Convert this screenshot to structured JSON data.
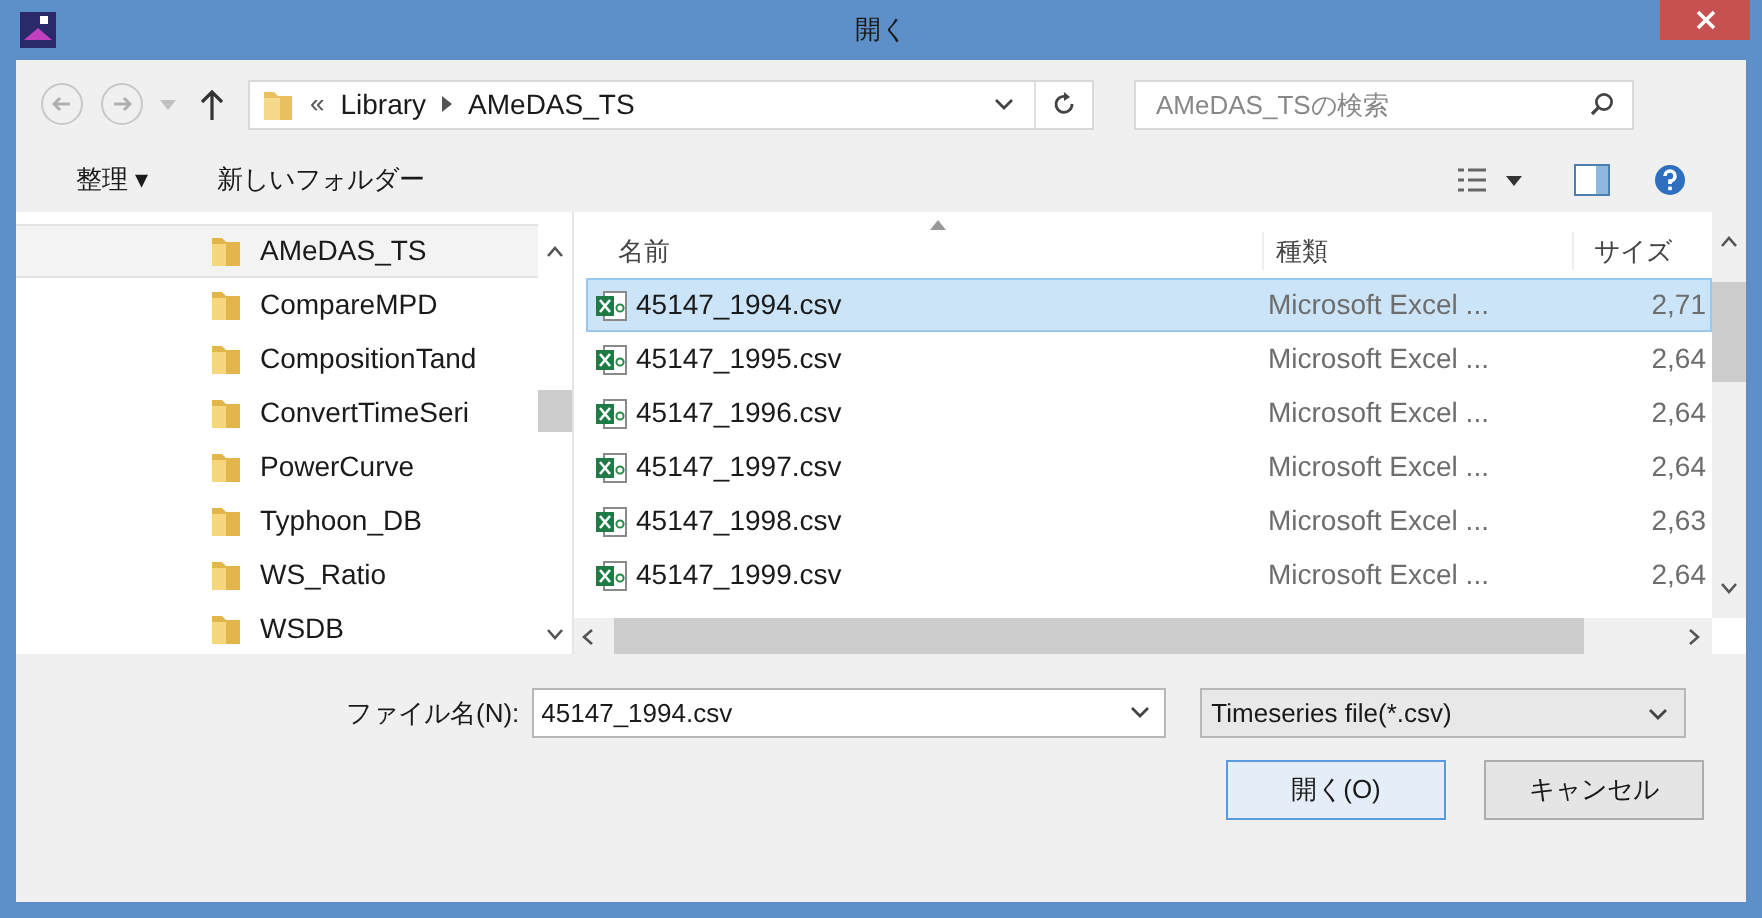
{
  "window": {
    "title": "開く"
  },
  "address": {
    "overflow": "«",
    "crumbs": [
      "Library",
      "AMeDAS_TS"
    ]
  },
  "search": {
    "placeholder": "AMeDAS_TSの検索"
  },
  "toolbar": {
    "organize": "整理 ▾",
    "new_folder": "新しいフォルダー"
  },
  "nav_items": [
    {
      "label": "AMeDAS_TS",
      "selected": true
    },
    {
      "label": "CompareMPD",
      "selected": false
    },
    {
      "label": "CompositionTand",
      "selected": false
    },
    {
      "label": "ConvertTimeSeri",
      "selected": false
    },
    {
      "label": "PowerCurve",
      "selected": false
    },
    {
      "label": "Typhoon_DB",
      "selected": false
    },
    {
      "label": "WS_Ratio",
      "selected": false
    },
    {
      "label": "WSDB",
      "selected": false
    }
  ],
  "columns": [
    "名前",
    "種類",
    "サイズ"
  ],
  "files": [
    {
      "name": "45147_1994.csv",
      "type": "Microsoft Excel ...",
      "size": "2,71",
      "selected": true
    },
    {
      "name": "45147_1995.csv",
      "type": "Microsoft Excel ...",
      "size": "2,64",
      "selected": false
    },
    {
      "name": "45147_1996.csv",
      "type": "Microsoft Excel ...",
      "size": "2,64",
      "selected": false
    },
    {
      "name": "45147_1997.csv",
      "type": "Microsoft Excel ...",
      "size": "2,64",
      "selected": false
    },
    {
      "name": "45147_1998.csv",
      "type": "Microsoft Excel ...",
      "size": "2,63",
      "selected": false
    },
    {
      "name": "45147_1999.csv",
      "type": "Microsoft Excel ...",
      "size": "2,64",
      "selected": false
    }
  ],
  "filename": {
    "label": "ファイル名(N):",
    "value": "45147_1994.csv"
  },
  "filter": {
    "value": "Timeseries file(*.csv)"
  },
  "buttons": [
    "開く(O)",
    "キャンセル"
  ]
}
